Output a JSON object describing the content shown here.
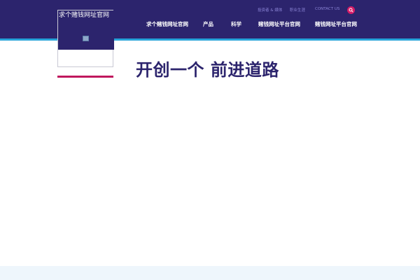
{
  "brand": {
    "site_title": "求个赌钱网址官网",
    "logo_alt_icon": "broken-image-icon",
    "accent_color": "#c0185d",
    "primary_color": "#2c246d",
    "stripe_color": "#27a3d8"
  },
  "utility_nav": {
    "items": [
      {
        "label": "投资者 & 媒体"
      },
      {
        "label": "职业生涯"
      },
      {
        "label": "CONTACT US"
      }
    ],
    "search_icon": "search-icon"
  },
  "main_nav": {
    "items": [
      {
        "label": "求个赌钱网址官网"
      },
      {
        "label": "产品"
      },
      {
        "label": "科学"
      },
      {
        "label": "赌钱网址平台官网"
      },
      {
        "label": "赌钱网址平台官网"
      }
    ]
  },
  "hero": {
    "title": "开创一个 前进道路"
  }
}
